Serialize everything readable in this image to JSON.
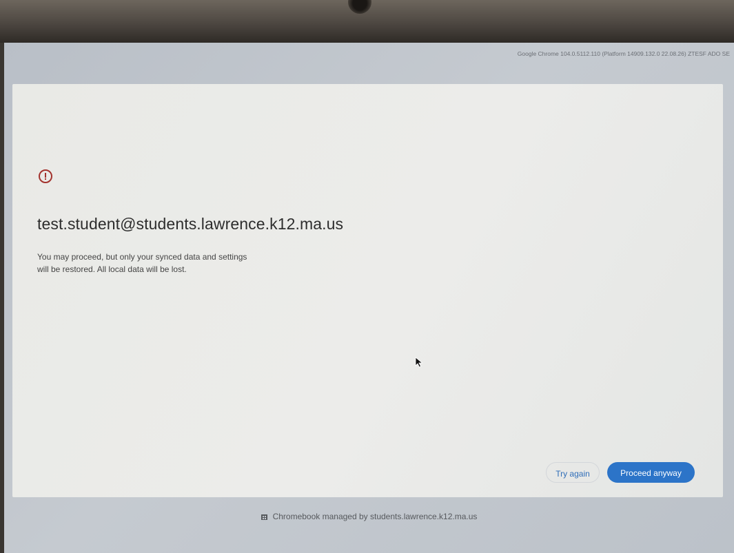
{
  "system": {
    "version_text": "Google Chrome 104.0.5112.110 (Platform 14909.132.0 22.08.26) ZTESF ADO SE"
  },
  "dialog": {
    "icon": "alert-circle-icon",
    "icon_color": "#a3332e",
    "title": "test.student@students.lawrence.k12.ma.us",
    "message": "You may proceed, but only your synced data and settings will be restored. All local data will be lost.",
    "buttons": {
      "try_again": "Try again",
      "proceed_anyway": "Proceed anyway"
    },
    "accent_color": "#2c74c8"
  },
  "footer": {
    "icon": "building-icon",
    "text": "Chromebook managed by students.lawrence.k12.ma.us"
  }
}
